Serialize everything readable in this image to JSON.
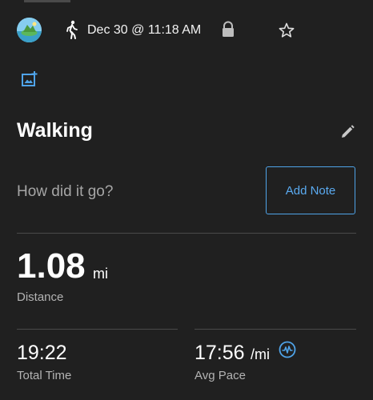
{
  "header": {
    "date_time": "Dec 30 @ 11:18 AM",
    "activity_icon": "walking-icon",
    "privacy_icon": "lock-icon",
    "favorite_icon": "star-outline-icon",
    "avatar_icon": "avatar-image"
  },
  "media": {
    "add_photo_icon": "add-photo-icon"
  },
  "activity": {
    "title": "Walking",
    "edit_icon": "pencil-icon"
  },
  "note": {
    "prompt": "How did it go?",
    "button_label": "Add Note"
  },
  "stats": {
    "distance": {
      "value": "1.08",
      "unit": "mi",
      "label": "Distance"
    },
    "total_time": {
      "value": "19:22",
      "label": "Total Time"
    },
    "avg_pace": {
      "value": "17:56",
      "unit": "/mi",
      "label": "Avg Pace",
      "icon": "pace-chart-icon"
    }
  },
  "colors": {
    "background": "#202020",
    "accent": "#4fa3e8",
    "text_primary": "#ffffff",
    "text_secondary": "#b3b3b3",
    "divider": "#4a4a4a"
  }
}
